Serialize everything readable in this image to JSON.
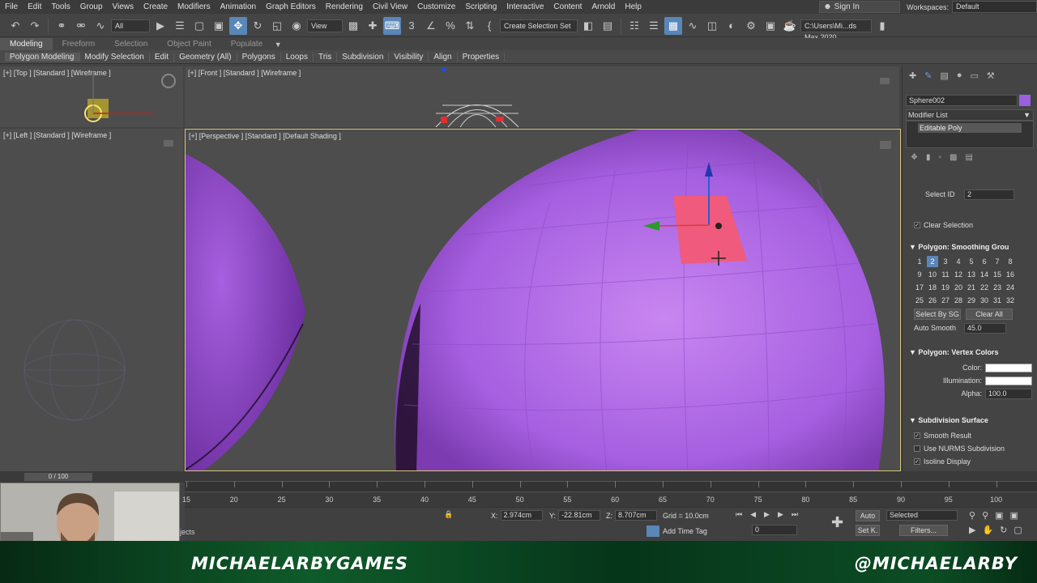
{
  "menubar": {
    "items": [
      "File",
      "Edit",
      "Tools",
      "Group",
      "Views",
      "Create",
      "Modifiers",
      "Animation",
      "Graph Editors",
      "Rendering",
      "Civil View",
      "Customize",
      "Scripting",
      "Interactive",
      "Content",
      "Arnold",
      "Help"
    ],
    "sign_in": "Sign In",
    "workspaces_label": "Workspaces:",
    "workspace_value": "Default"
  },
  "toolbar": {
    "filter_value": "All",
    "view_value": "View",
    "selection_set": "Create Selection Set",
    "path": "C:\\Users\\Mi...ds Max 2020"
  },
  "ribbon": {
    "tabs": [
      "Modeling",
      "Freeform",
      "Selection",
      "Object Paint",
      "Populate"
    ],
    "items": [
      "Polygon Modeling",
      "Modify Selection",
      "Edit",
      "Geometry (All)",
      "Polygons",
      "Loops",
      "Tris",
      "Subdivision",
      "Visibility",
      "Align",
      "Properties"
    ]
  },
  "viewports": {
    "top": "[+] [Top ] [Standard ] [Wireframe ]",
    "front": "[+] [Front ] [Standard ] [Wireframe ]",
    "left": "[+] [Left ] [Standard ] [Wireframe ]",
    "perspective": "[+] [Perspective ] [Standard ] [Default Shading ]"
  },
  "command_panel": {
    "object_name": "Sphere002",
    "object_color": "#9b5fe0",
    "modifier_list": "Modifier List",
    "stack_item": "Editable Poly",
    "select_id_label": "Select ID",
    "select_id_value": "2",
    "clear_selection": "Clear Selection",
    "smoothing_title": "Polygon: Smoothing Grou",
    "smoothing_groups": [
      "1",
      "2",
      "3",
      "4",
      "5",
      "6",
      "7",
      "8",
      "9",
      "10",
      "11",
      "12",
      "13",
      "14",
      "15",
      "16",
      "17",
      "18",
      "19",
      "20",
      "21",
      "22",
      "23",
      "24",
      "25",
      "26",
      "27",
      "28",
      "29",
      "30",
      "31",
      "32"
    ],
    "select_by_sg": "Select By SG",
    "clear_all": "Clear All",
    "auto_smooth_label": "Auto Smooth",
    "auto_smooth_value": "45.0",
    "vertex_colors_title": "Polygon: Vertex Colors",
    "color_label": "Color:",
    "illumination_label": "Illumination:",
    "alpha_label": "Alpha:",
    "alpha_value": "100.0",
    "subdivision_title": "Subdivision Surface",
    "smooth_result": "Smooth Result",
    "use_nurms": "Use NURMS Subdivision",
    "isoline": "Isoline Display"
  },
  "timeline": {
    "frame_counter": "0 / 100",
    "ticks": [
      "15",
      "20",
      "25",
      "30",
      "35",
      "40",
      "45",
      "50",
      "55",
      "60",
      "65",
      "70",
      "75",
      "80",
      "85",
      "90",
      "95",
      "100"
    ]
  },
  "status": {
    "x_label": "X:",
    "x_value": "2.974cm",
    "y_label": "Y:",
    "y_value": "-22.81cm",
    "z_label": "Z:",
    "z_value": "8.707cm",
    "grid": "Grid = 10.0cm",
    "add_time_tag": "Add Time Tag",
    "auto": "Auto",
    "set_key": "Set K.",
    "selected": "Selected",
    "filters": "Filters...",
    "frame": "0",
    "objects_fragment": "jects"
  },
  "banner": {
    "left": "MICHAELARBYGAMES",
    "right": "@MICHAELARBY"
  },
  "colors": {
    "sphere": "#a45ee0",
    "selected_poly": "#f0587a",
    "accent": "#5a86b8"
  }
}
